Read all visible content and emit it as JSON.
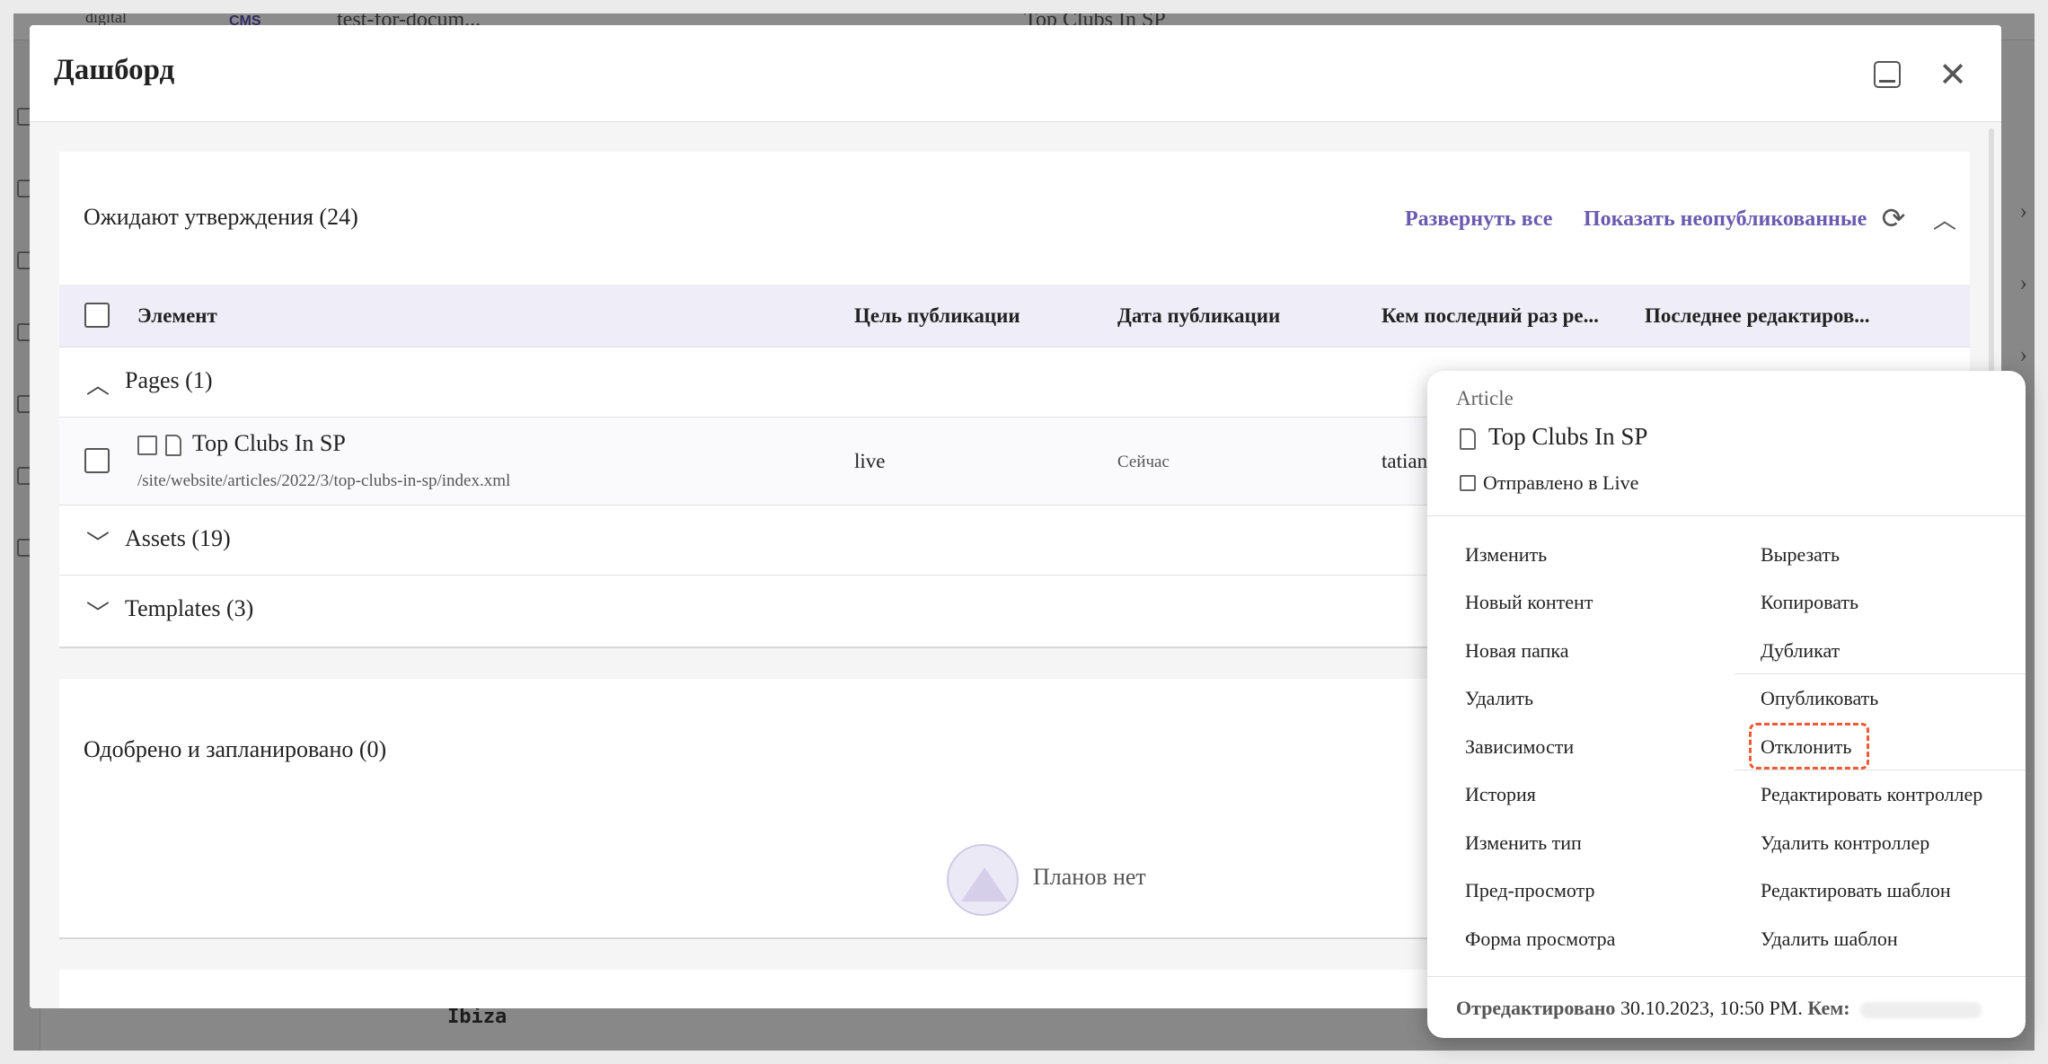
{
  "background": {
    "topbar_items": [
      "digital",
      "CMS",
      "test-for-docum...",
      "Top Clubs In SP"
    ],
    "bottom_text": "Ibiza"
  },
  "dialog": {
    "title": "Дашборд"
  },
  "pending": {
    "title": "Ожидают утверждения (24)",
    "expand_all": "Развернуть все",
    "show_unpublished": "Показать неопубликованные",
    "columns": [
      "Элемент",
      "Цель публикации",
      "Дата публикации",
      "Кем последний раз ре...",
      "Последнее редактиров..."
    ],
    "groups": [
      {
        "label": "Pages (1)"
      },
      {
        "label": "Assets (19)"
      },
      {
        "label": "Templates (3)"
      }
    ],
    "item": {
      "title": "Top Clubs In SP",
      "path": "/site/website/articles/2022/3/top-clubs-in-sp/index.xml",
      "target": "live",
      "date": "Сейчас",
      "editor": "tatian"
    }
  },
  "approved": {
    "title": "Одобрено и запланировано (0)",
    "empty_text": "Планов нет"
  },
  "context_menu": {
    "type": "Article",
    "name": "Top Clubs In SP",
    "status": "Отправлено в Live",
    "left_items": [
      "Изменить",
      "Новый контент",
      "Новая папка",
      "Удалить",
      "Зависимости",
      "История",
      "Изменить тип",
      "Пред-просмотр",
      "Форма просмотра"
    ],
    "right_items": [
      "Вырезать",
      "Копировать",
      "Дубликат",
      "Опубликовать",
      "Отклонить",
      "Редактировать контроллер",
      "Удалить контроллер",
      "Редактировать шаблон",
      "Удалить шаблон"
    ],
    "footer_label": "Отредактировано",
    "footer_date": "30.10.2023, 10:50 PM.",
    "footer_by": "Кем:",
    "highlight_color": "#ef5a32"
  },
  "colors": {
    "accent": "#6a5bb0",
    "table_header_bg": "#efeef8"
  }
}
